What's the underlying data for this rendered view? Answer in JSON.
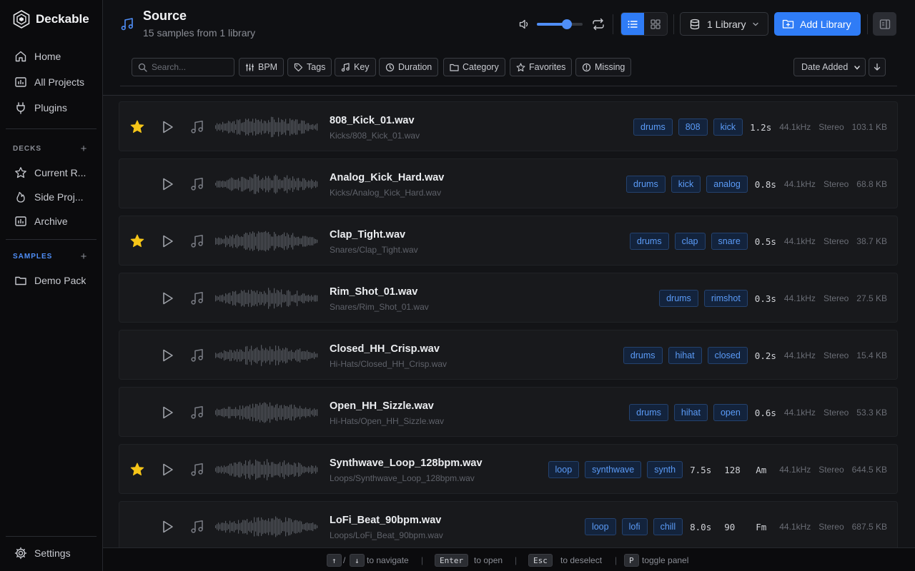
{
  "app": {
    "name": "Deckable"
  },
  "nav": {
    "home": "Home",
    "projects": "All Projects",
    "plugins": "Plugins",
    "decks_title": "DECKS",
    "decks": [
      "Current R...",
      "Side Proj...",
      "Archive"
    ],
    "samples_title": "SAMPLES",
    "samples": [
      "Demo Pack"
    ],
    "settings": "Settings"
  },
  "header": {
    "title": "Source",
    "subtitle": "15 samples from 1 library",
    "volume": 0.66,
    "library_select": "1 Library",
    "add_library": "Add Library"
  },
  "filters": {
    "search_placeholder": "Search...",
    "bpm": "BPM",
    "tags": "Tags",
    "key": "Key",
    "duration": "Duration",
    "category": "Category",
    "favorites": "Favorites",
    "missing": "Missing",
    "sort": "Date Added"
  },
  "samples": [
    {
      "name": "808_Kick_01.wav",
      "path": "Kicks/808_Kick_01.wav",
      "favorite": true,
      "tags": [
        "drums",
        "808",
        "kick"
      ],
      "duration": "1.2s",
      "bpm": "",
      "key": "",
      "rate": "44.1kHz",
      "channels": "Stereo",
      "size": "103.1 KB"
    },
    {
      "name": "Analog_Kick_Hard.wav",
      "path": "Kicks/Analog_Kick_Hard.wav",
      "favorite": false,
      "tags": [
        "drums",
        "kick",
        "analog"
      ],
      "duration": "0.8s",
      "bpm": "",
      "key": "",
      "rate": "44.1kHz",
      "channels": "Stereo",
      "size": "68.8 KB"
    },
    {
      "name": "Clap_Tight.wav",
      "path": "Snares/Clap_Tight.wav",
      "favorite": true,
      "tags": [
        "drums",
        "clap",
        "snare"
      ],
      "duration": "0.5s",
      "bpm": "",
      "key": "",
      "rate": "44.1kHz",
      "channels": "Stereo",
      "size": "38.7 KB"
    },
    {
      "name": "Rim_Shot_01.wav",
      "path": "Snares/Rim_Shot_01.wav",
      "favorite": false,
      "tags": [
        "drums",
        "rimshot"
      ],
      "duration": "0.3s",
      "bpm": "",
      "key": "",
      "rate": "44.1kHz",
      "channels": "Stereo",
      "size": "27.5 KB"
    },
    {
      "name": "Closed_HH_Crisp.wav",
      "path": "Hi-Hats/Closed_HH_Crisp.wav",
      "favorite": false,
      "tags": [
        "drums",
        "hihat",
        "closed"
      ],
      "duration": "0.2s",
      "bpm": "",
      "key": "",
      "rate": "44.1kHz",
      "channels": "Stereo",
      "size": "15.4 KB"
    },
    {
      "name": "Open_HH_Sizzle.wav",
      "path": "Hi-Hats/Open_HH_Sizzle.wav",
      "favorite": false,
      "tags": [
        "drums",
        "hihat",
        "open"
      ],
      "duration": "0.6s",
      "bpm": "",
      "key": "",
      "rate": "44.1kHz",
      "channels": "Stereo",
      "size": "53.3 KB"
    },
    {
      "name": "Synthwave_Loop_128bpm.wav",
      "path": "Loops/Synthwave_Loop_128bpm.wav",
      "favorite": true,
      "tags": [
        "loop",
        "synthwave",
        "synth"
      ],
      "duration": "7.5s",
      "bpm": "128",
      "key": "Am",
      "rate": "44.1kHz",
      "channels": "Stereo",
      "size": "644.5 KB"
    },
    {
      "name": "LoFi_Beat_90bpm.wav",
      "path": "Loops/LoFi_Beat_90bpm.wav",
      "favorite": false,
      "tags": [
        "loop",
        "lofi",
        "chill"
      ],
      "duration": "8.0s",
      "bpm": "90",
      "key": "Fm",
      "rate": "44.1kHz",
      "channels": "Stereo",
      "size": "687.5 KB"
    }
  ],
  "footer": {
    "up": "↑",
    "slash": "/",
    "down": "↓",
    "navigate": "to navigate",
    "enter": "Enter",
    "open": "to open",
    "esc": "Esc",
    "deselect": "to deselect",
    "p": "P",
    "toggle": "toggle panel"
  },
  "colors": {
    "accent": "#2f7cf6",
    "star": "#f5c518",
    "tag_text": "#5b9bf7"
  }
}
